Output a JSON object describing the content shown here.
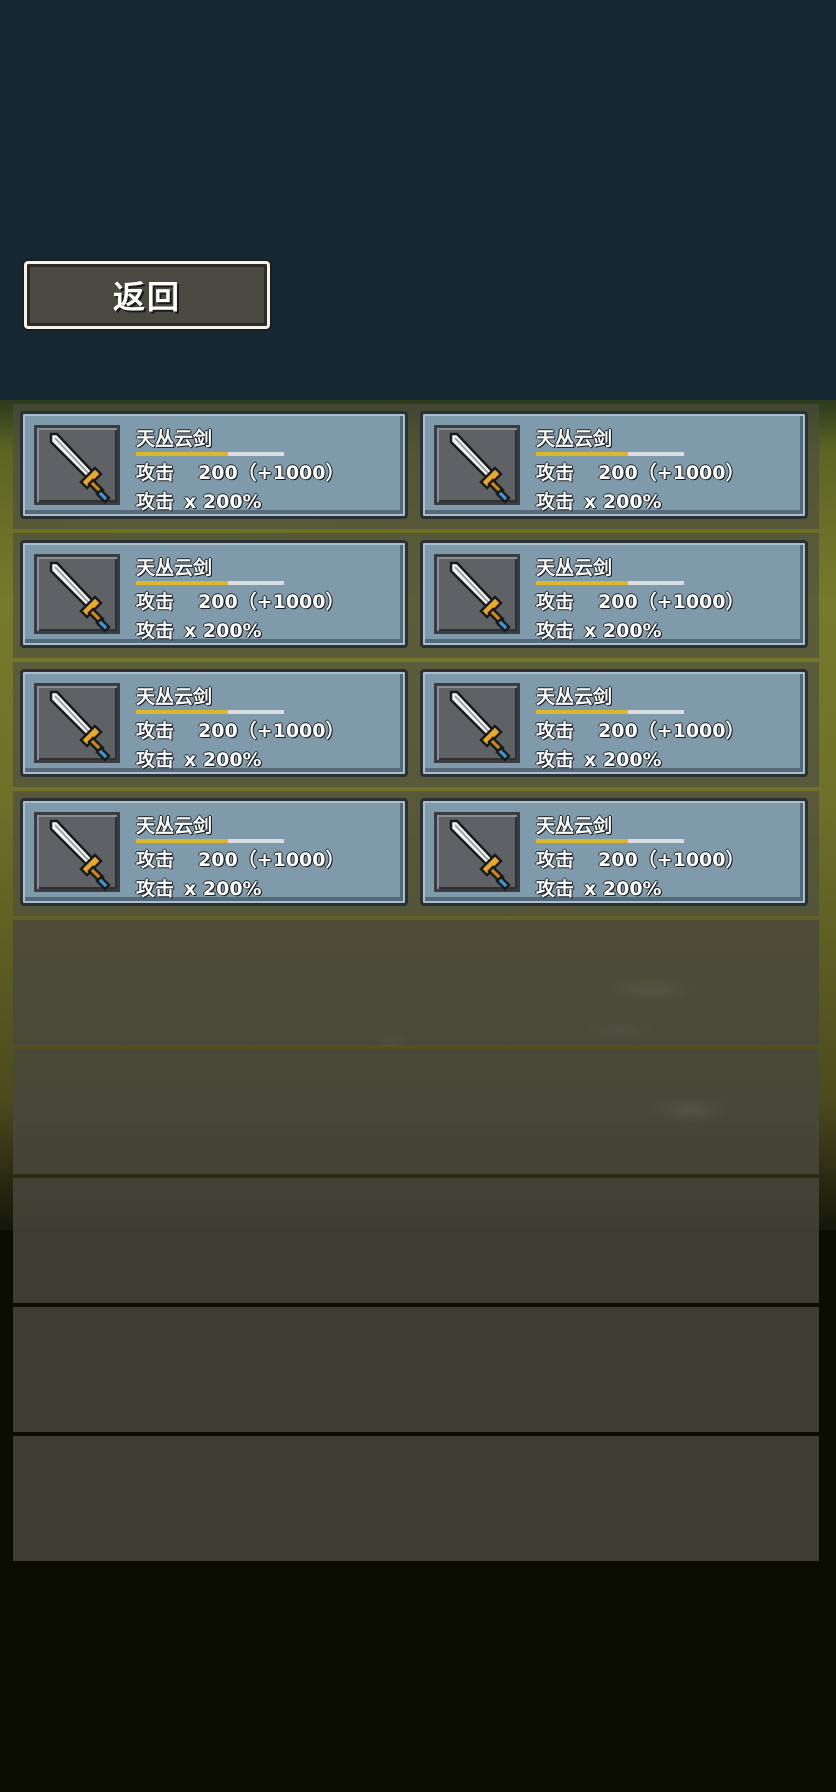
{
  "back_button": {
    "label": "返回"
  },
  "inventory": {
    "items": [
      {
        "name": "天丛云剑",
        "stat1_label": "攻击",
        "stat1_value": "200（+1000）",
        "stat2_label": "攻击",
        "stat2_value": "x 200%",
        "icon": "sword-icon",
        "bar_fill_fraction": 0.62
      },
      {
        "name": "天丛云剑",
        "stat1_label": "攻击",
        "stat1_value": "200（+1000）",
        "stat2_label": "攻击",
        "stat2_value": "x 200%",
        "icon": "sword-icon",
        "bar_fill_fraction": 0.62
      },
      {
        "name": "天丛云剑",
        "stat1_label": "攻击",
        "stat1_value": "200（+1000）",
        "stat2_label": "攻击",
        "stat2_value": "x 200%",
        "icon": "sword-icon",
        "bar_fill_fraction": 0.62
      },
      {
        "name": "天丛云剑",
        "stat1_label": "攻击",
        "stat1_value": "200（+1000）",
        "stat2_label": "攻击",
        "stat2_value": "x 200%",
        "icon": "sword-icon",
        "bar_fill_fraction": 0.62
      },
      {
        "name": "天丛云剑",
        "stat1_label": "攻击",
        "stat1_value": "200（+1000）",
        "stat2_label": "攻击",
        "stat2_value": "x 200%",
        "icon": "sword-icon",
        "bar_fill_fraction": 0.62
      },
      {
        "name": "天丛云剑",
        "stat1_label": "攻击",
        "stat1_value": "200（+1000）",
        "stat2_label": "攻击",
        "stat2_value": "x 200%",
        "icon": "sword-icon",
        "bar_fill_fraction": 0.62
      },
      {
        "name": "天丛云剑",
        "stat1_label": "攻击",
        "stat1_value": "200（+1000）",
        "stat2_label": "攻击",
        "stat2_value": "x 200%",
        "icon": "sword-icon",
        "bar_fill_fraction": 0.62
      },
      {
        "name": "天丛云剑",
        "stat1_label": "攻击",
        "stat1_value": "200（+1000）",
        "stat2_label": "攻击",
        "stat2_value": "x 200%",
        "icon": "sword-icon",
        "bar_fill_fraction": 0.62
      }
    ],
    "empty_rows": 5
  },
  "colors": {
    "sky": "#172835",
    "card": "#7f9aab",
    "bar_fill": "#d9b82c",
    "button": "#4a4a42"
  }
}
